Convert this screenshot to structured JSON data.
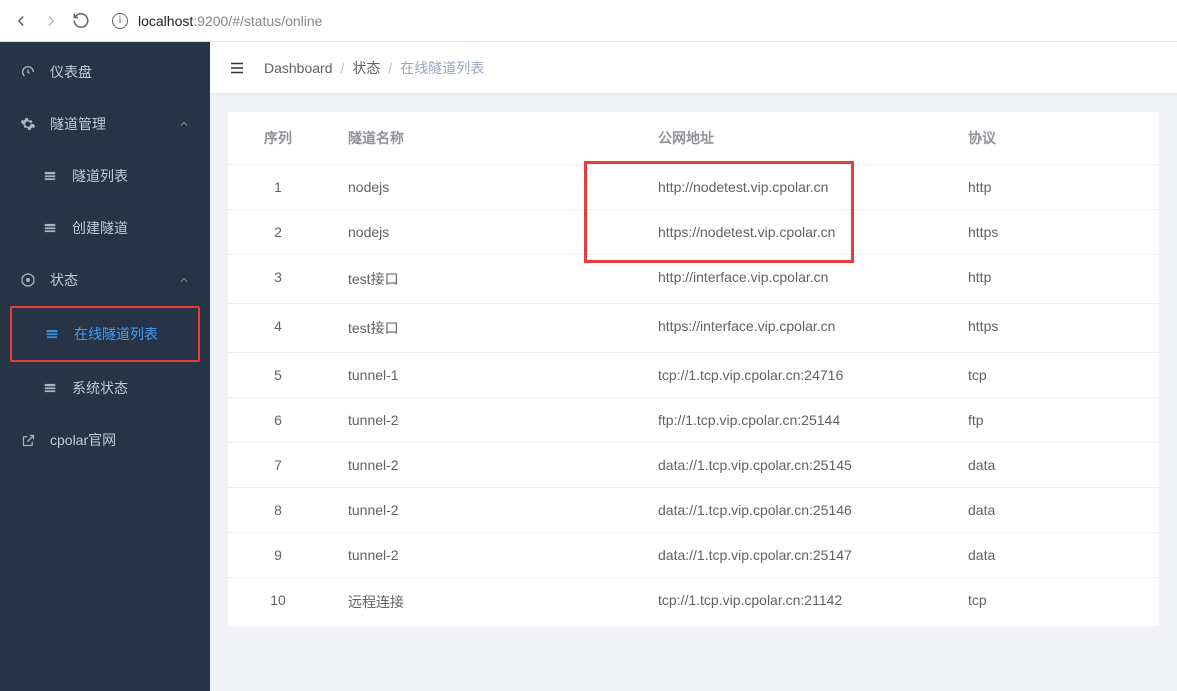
{
  "browser": {
    "url_host": "localhost",
    "url_rest": ":9200/#/status/online"
  },
  "sidebar": {
    "dashboard": "仪表盘",
    "tunnel_mgmt": "隧道管理",
    "tunnel_list": "隧道列表",
    "create_tunnel": "创建隧道",
    "status": "状态",
    "online_list": "在线隧道列表",
    "system_status": "系统状态",
    "cpolar_site": "cpolar官网"
  },
  "breadcrumb": {
    "a": "Dashboard",
    "b": "状态",
    "c": "在线隧道列表"
  },
  "table": {
    "headers": {
      "idx": "序列",
      "name": "隧道名称",
      "url": "公网地址",
      "proto": "协议"
    },
    "rows": [
      {
        "idx": "1",
        "name": "nodejs",
        "url": "http://nodetest.vip.cpolar.cn",
        "proto": "http"
      },
      {
        "idx": "2",
        "name": "nodejs",
        "url": "https://nodetest.vip.cpolar.cn",
        "proto": "https"
      },
      {
        "idx": "3",
        "name": "test接口",
        "url": "http://interface.vip.cpolar.cn",
        "proto": "http"
      },
      {
        "idx": "4",
        "name": "test接口",
        "url": "https://interface.vip.cpolar.cn",
        "proto": "https"
      },
      {
        "idx": "5",
        "name": "tunnel-1",
        "url": "tcp://1.tcp.vip.cpolar.cn:24716",
        "proto": "tcp"
      },
      {
        "idx": "6",
        "name": "tunnel-2",
        "url": "ftp://1.tcp.vip.cpolar.cn:25144",
        "proto": "ftp"
      },
      {
        "idx": "7",
        "name": "tunnel-2",
        "url": "data://1.tcp.vip.cpolar.cn:25145",
        "proto": "data"
      },
      {
        "idx": "8",
        "name": "tunnel-2",
        "url": "data://1.tcp.vip.cpolar.cn:25146",
        "proto": "data"
      },
      {
        "idx": "9",
        "name": "tunnel-2",
        "url": "data://1.tcp.vip.cpolar.cn:25147",
        "proto": "data"
      },
      {
        "idx": "10",
        "name": "远程连接",
        "url": "tcp://1.tcp.vip.cpolar.cn:21142",
        "proto": "tcp"
      }
    ]
  }
}
